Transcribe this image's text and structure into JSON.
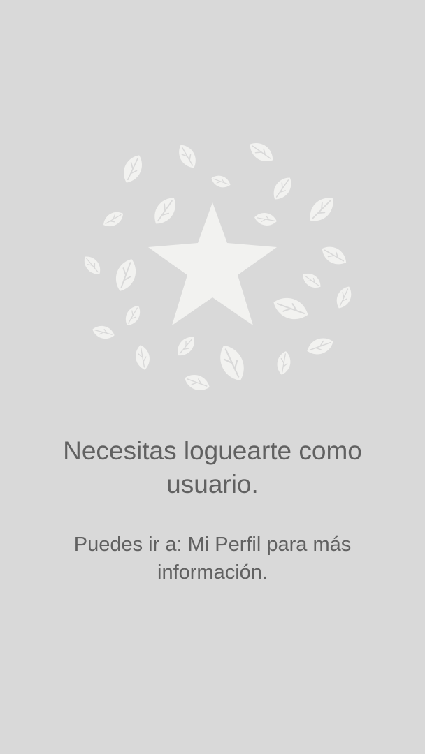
{
  "empty_state": {
    "illustration_icon": "star-with-leaves-icon",
    "title": "Necesitas loguearte como usuario.",
    "subtitle": "Puedes ir a: Mi Perfil para más información."
  },
  "colors": {
    "background": "#d9d9d9",
    "illustration": "#f2f2f0",
    "text": "#616161"
  }
}
